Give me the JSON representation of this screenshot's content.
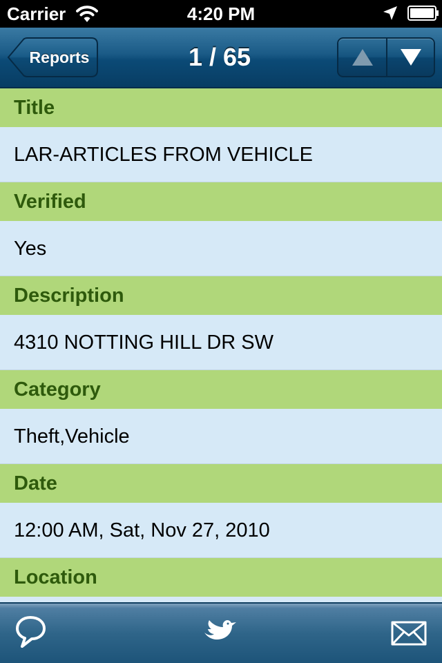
{
  "status_bar": {
    "carrier": "Carrier",
    "time": "4:20 PM"
  },
  "nav": {
    "back_label": "Reports",
    "title": "1 / 65",
    "prev_icon": "triangle-up-icon",
    "next_icon": "triangle-down-icon"
  },
  "fields": [
    {
      "label": "Title",
      "value": "LAR-ARTICLES FROM VEHICLE"
    },
    {
      "label": "Verified",
      "value": "Yes"
    },
    {
      "label": "Description",
      "value": "4310 NOTTING HILL DR SW"
    },
    {
      "label": "Category",
      "value": "Theft,Vehicle"
    },
    {
      "label": "Date",
      "value": "12:00 AM, Sat, Nov 27, 2010"
    },
    {
      "label": "Location",
      "value": ""
    }
  ],
  "toolbar": {
    "icons": [
      "speech-bubble-icon",
      "twitter-bird-icon",
      "mail-envelope-icon"
    ]
  },
  "colors": {
    "label_bg": "#b0d77a",
    "label_text": "#2e5a0c",
    "value_bg": "#d6e9f7",
    "nav_bar": "#0b4a76"
  }
}
